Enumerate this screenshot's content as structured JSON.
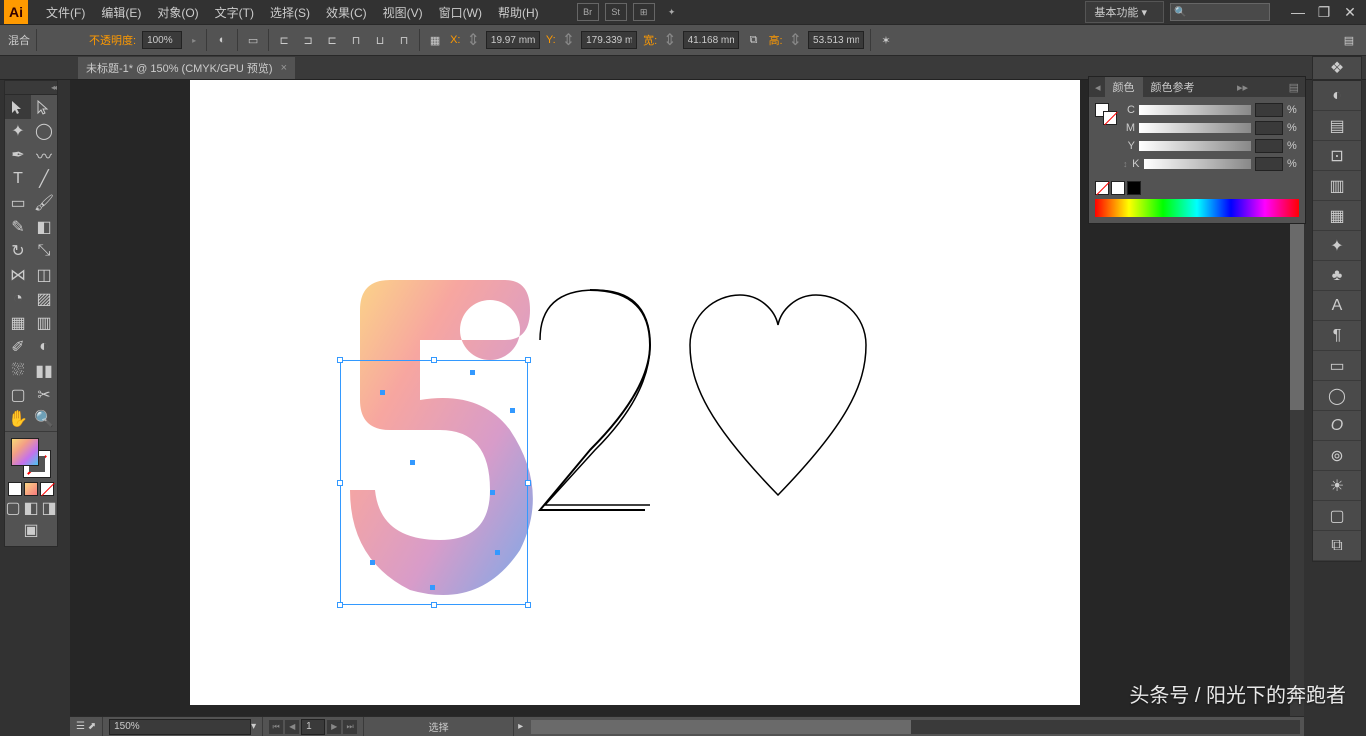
{
  "app": {
    "icon_text": "Ai"
  },
  "menubar": {
    "items": [
      "文件(F)",
      "编辑(E)",
      "对象(O)",
      "文字(T)",
      "选择(S)",
      "效果(C)",
      "视图(V)",
      "窗口(W)",
      "帮助(H)"
    ],
    "icons": [
      "Br",
      "St"
    ],
    "workspace": "基本功能"
  },
  "controlbar": {
    "mode": "混合",
    "opacity_label": "不透明度:",
    "opacity_value": "100%",
    "x_label": "X:",
    "x_value": "19.97 mm",
    "y_label": "Y:",
    "y_value": "179.339 m",
    "w_label": "宽:",
    "w_value": "41.168 mm",
    "h_label": "高:",
    "h_value": "53.513 mm"
  },
  "document": {
    "tab_title": "未标题-1* @ 150% (CMYK/GPU 预览)"
  },
  "color_panel": {
    "tab1": "颜色",
    "tab2": "颜色参考",
    "channels": [
      "C",
      "M",
      "Y",
      "K"
    ],
    "pct": "%"
  },
  "statusbar": {
    "zoom": "150%",
    "page": "1",
    "tool": "选择"
  },
  "watermark": "头条号 / 阳光下的奔跑者"
}
